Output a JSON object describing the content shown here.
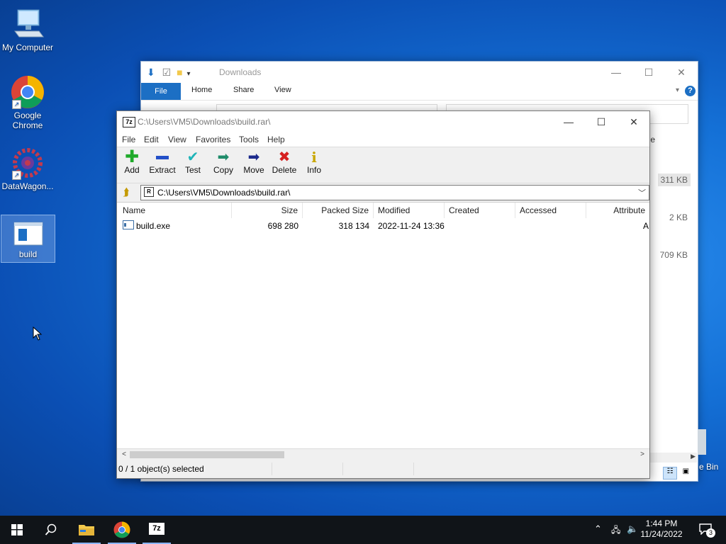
{
  "desktop": {
    "icons": [
      {
        "label": "My Computer"
      },
      {
        "label": "Google Chrome"
      },
      {
        "label": "DataWagon..."
      },
      {
        "label": "build"
      },
      {
        "label": "e Bin"
      }
    ]
  },
  "explorer": {
    "title": "Downloads",
    "tabs": {
      "file": "File",
      "home": "Home",
      "share": "Share",
      "view": "View"
    },
    "partial_header": "e",
    "sizes": [
      "311 KB",
      "2 KB",
      "709 KB"
    ]
  },
  "sevenzip": {
    "title": "C:\\Users\\VM5\\Downloads\\build.rar\\",
    "menu": [
      "File",
      "Edit",
      "View",
      "Favorites",
      "Tools",
      "Help"
    ],
    "toolbar": {
      "add": "Add",
      "extract": "Extract",
      "test": "Test",
      "copy": "Copy",
      "move": "Move",
      "delete": "Delete",
      "info": "Info"
    },
    "path": "C:\\Users\\VM5\\Downloads\\build.rar\\",
    "columns": {
      "name": "Name",
      "size": "Size",
      "packed": "Packed Size",
      "modified": "Modified",
      "created": "Created",
      "accessed": "Accessed",
      "attributes": "Attribute"
    },
    "rows": [
      {
        "name": "build.exe",
        "size": "698 280",
        "packed": "318 134",
        "modified": "2022-11-24 13:36",
        "created": "",
        "accessed": "",
        "attributes": "A"
      }
    ],
    "status": "0 / 1 object(s) selected"
  },
  "taskbar": {
    "time": "1:44 PM",
    "date": "11/24/2022",
    "notifications": "3",
    "sevenzip_label": "7z"
  },
  "colors": {
    "accent": "#1c6fc4",
    "taskbar": "#101418"
  }
}
